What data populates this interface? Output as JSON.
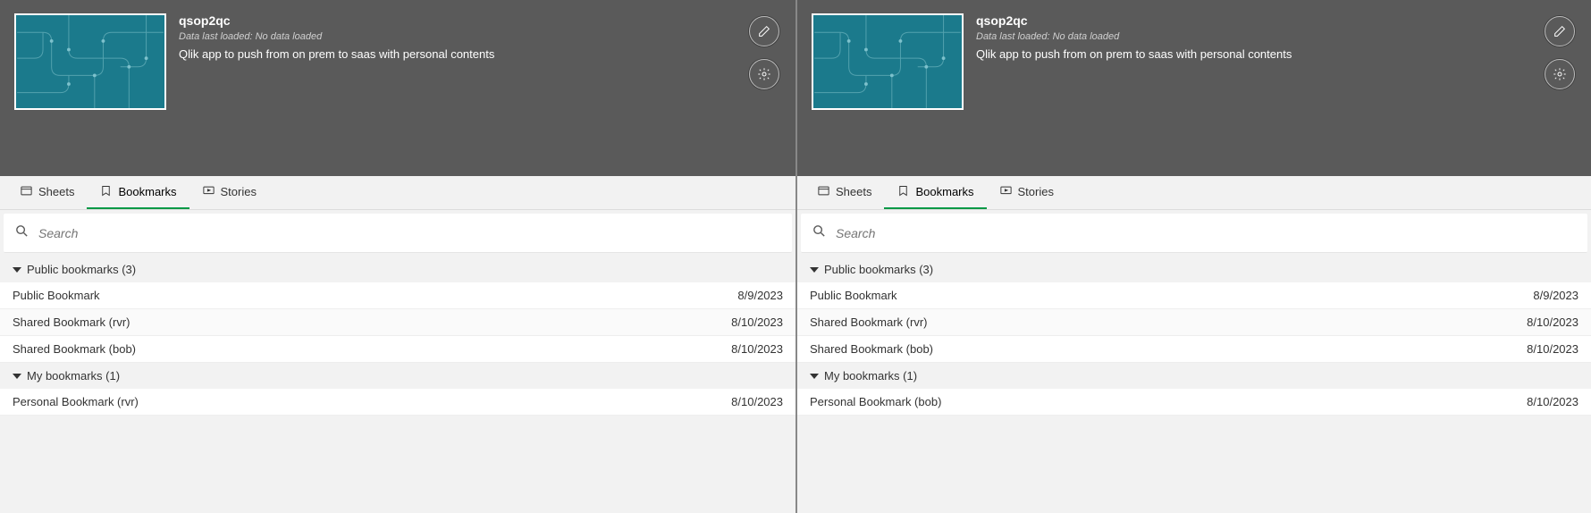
{
  "panes": [
    {
      "app": {
        "title": "qsop2qc",
        "data_status": "Data last loaded: No data loaded",
        "description": "Qlik app to push from on prem to saas with personal contents"
      },
      "tabs": [
        {
          "label": "Sheets",
          "active": false
        },
        {
          "label": "Bookmarks",
          "active": true
        },
        {
          "label": "Stories",
          "active": false
        }
      ],
      "search_placeholder": "Search",
      "sections": [
        {
          "title": "Public bookmarks (3)",
          "items": [
            {
              "name": "Public Bookmark",
              "date": "8/9/2023"
            },
            {
              "name": "Shared Bookmark (rvr)",
              "date": "8/10/2023"
            },
            {
              "name": "Shared Bookmark (bob)",
              "date": "8/10/2023"
            }
          ]
        },
        {
          "title": "My bookmarks (1)",
          "items": [
            {
              "name": "Personal Bookmark (rvr)",
              "date": "8/10/2023"
            }
          ]
        }
      ]
    },
    {
      "app": {
        "title": "qsop2qc",
        "data_status": "Data last loaded: No data loaded",
        "description": "Qlik app to push from on prem to saas with personal contents"
      },
      "tabs": [
        {
          "label": "Sheets",
          "active": false
        },
        {
          "label": "Bookmarks",
          "active": true
        },
        {
          "label": "Stories",
          "active": false
        }
      ],
      "search_placeholder": "Search",
      "sections": [
        {
          "title": "Public bookmarks (3)",
          "items": [
            {
              "name": "Public Bookmark",
              "date": "8/9/2023"
            },
            {
              "name": "Shared Bookmark (rvr)",
              "date": "8/10/2023"
            },
            {
              "name": "Shared Bookmark (bob)",
              "date": "8/10/2023"
            }
          ]
        },
        {
          "title": "My bookmarks (1)",
          "items": [
            {
              "name": "Personal Bookmark (bob)",
              "date": "8/10/2023"
            }
          ]
        }
      ]
    }
  ]
}
